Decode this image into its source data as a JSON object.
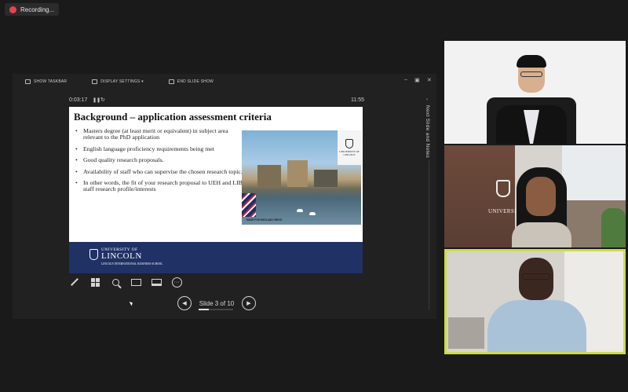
{
  "recording": {
    "label": "Recording..."
  },
  "presenter_toolbar": {
    "show_taskbar": "SHOW TASKBAR",
    "display_settings": "DISPLAY SETTINGS ▾",
    "end_slide_show": "END SLIDE SHOW"
  },
  "window_controls": {
    "minimize": "–",
    "restore": "▣",
    "close": "✕"
  },
  "timer": {
    "elapsed": "0:03:17",
    "clock": "11:55"
  },
  "side_panel": {
    "label": "Next Slide and Notes"
  },
  "slide": {
    "title": "Background – application assessment criteria",
    "bullets": [
      "Masters degree (at least merit or equivalent) in subject area relevant to the PhD application",
      "English language proficiency requirements being met",
      "Good quality research proposals.",
      "Availability of staff who can supervise the chosen research topic.",
      "In other words, the fit of your research proposal to UEH and LIBS staff research profile/interests"
    ],
    "photo_logo_text": "UNIVERSITY OF LINCOLN",
    "flag_caption": "MADE FOR ENGLAND GREAT",
    "footer": {
      "university": "UNIVERSITY OF",
      "lincoln": "LINCOLN",
      "school": "LINCOLN INTERNATIONAL BUSINESS SCHOOL"
    }
  },
  "navigation": {
    "slide_counter": "Slide 3 of 10",
    "prev_icon": "◀",
    "next_icon": "▶",
    "progress": 0.3
  },
  "participants": {
    "sign_text": "UNIVERSITY OF LINCOLN",
    "active_speaker_color": "#cddc4a"
  }
}
